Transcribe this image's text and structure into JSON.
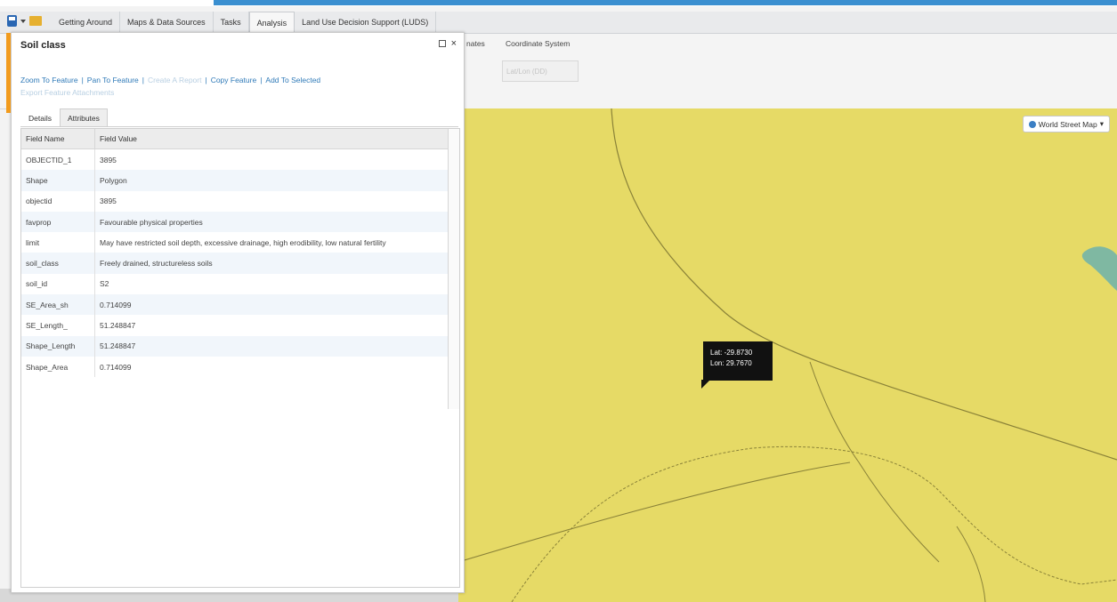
{
  "menu": {
    "tabs": [
      "Getting Around",
      "Maps & Data Sources",
      "Tasks",
      "Analysis",
      "Land Use Decision Support (LUDS)"
    ],
    "active_tab": "Analysis"
  },
  "ribbon": {
    "partial_group_label": "nates",
    "coordinate_system_label": "Coordinate System",
    "projection_value": "Lat/Lon (DD)"
  },
  "panel": {
    "title": "Soil class",
    "actions": {
      "zoom": "Zoom To Feature",
      "pan": "Pan To Feature",
      "report": "Create A Report",
      "copy": "Copy Feature",
      "add": "Add To Selected",
      "export": "Export Feature Attachments"
    },
    "tabs": [
      "Details",
      "Attributes"
    ],
    "active_tab": "Attributes",
    "table": {
      "headers": [
        "Field Name",
        "Field Value"
      ],
      "rows": [
        {
          "name": "OBJECTID_1",
          "value": "3895"
        },
        {
          "name": "Shape",
          "value": "Polygon"
        },
        {
          "name": "objectid",
          "value": "3895"
        },
        {
          "name": "favprop",
          "value": "Favourable physical properties"
        },
        {
          "name": "limit",
          "value": "May have restricted soil depth, excessive drainage, high erodibility, low natural fertility"
        },
        {
          "name": "soil_class",
          "value": "Freely drained, structureless soils"
        },
        {
          "name": "soil_id",
          "value": "S2"
        },
        {
          "name": "SE_Area_sh",
          "value": "0.714099"
        },
        {
          "name": "SE_Length_",
          "value": "51.248847"
        },
        {
          "name": "Shape_Length",
          "value": "51.248847"
        },
        {
          "name": "Shape_Area",
          "value": "0.714099"
        }
      ]
    }
  },
  "map": {
    "basemap_label": "World Street Map",
    "tooltip": {
      "lat": "Lat:  -29.8730",
      "lon": "Lon:   29.7670"
    },
    "colors": {
      "land": "#e6da66",
      "water": "#7fb8a2",
      "road": "#7a7330"
    }
  }
}
